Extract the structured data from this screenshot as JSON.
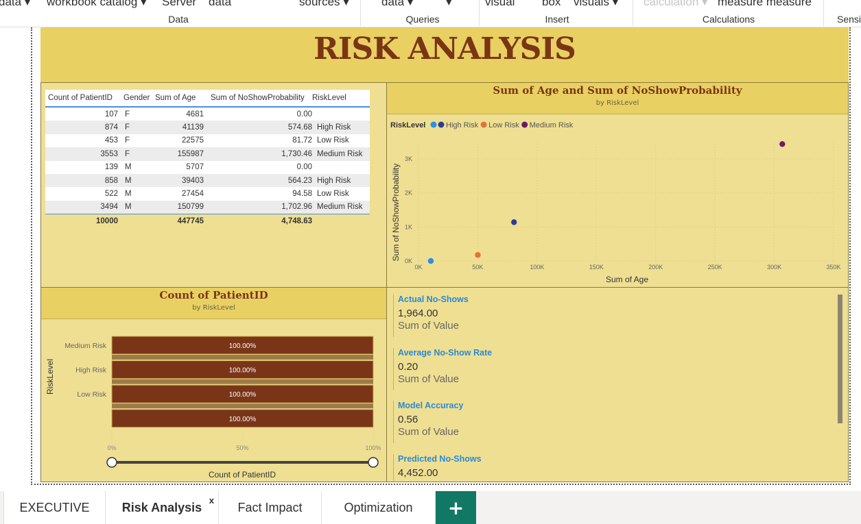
{
  "ribbon": {
    "top_fragments": [
      "data ▾",
      "workbook catalog ▾",
      "Server",
      "data",
      "sources ▾",
      "data ▾",
      "▾",
      "visual",
      "box",
      "visuals ▾",
      "calculation ▾",
      "measure measure"
    ],
    "groups": [
      "Data",
      "Queries",
      "Insert",
      "Calculations",
      "Sensi"
    ]
  },
  "report": {
    "title": "RISK ANALYSIS"
  },
  "table": {
    "columns": [
      "Count of PatientID",
      "Gender",
      "Sum of Age",
      "Sum of NoShowProbability",
      "RiskLevel"
    ],
    "rows": [
      [
        "107",
        "F",
        "4681",
        "0.00",
        ""
      ],
      [
        "874",
        "F",
        "41139",
        "574.68",
        "High Risk"
      ],
      [
        "453",
        "F",
        "22575",
        "81.72",
        "Low Risk"
      ],
      [
        "3553",
        "F",
        "155987",
        "1,730.46",
        "Medium Risk"
      ],
      [
        "139",
        "M",
        "5707",
        "0.00",
        ""
      ],
      [
        "858",
        "M",
        "39403",
        "564.23",
        "High Risk"
      ],
      [
        "522",
        "M",
        "27454",
        "94.58",
        "Low Risk"
      ],
      [
        "3494",
        "M",
        "150799",
        "1,702.96",
        "Medium Risk"
      ]
    ],
    "total": [
      "10000",
      "",
      "447745",
      "4,748.63",
      ""
    ]
  },
  "chart_data": [
    {
      "type": "scatter",
      "title": "Sum of Age and Sum of NoShowProbability",
      "subtitle": "by RiskLevel",
      "xlabel": "Sum of Age",
      "ylabel": "Sum of NoShowProbability",
      "legend_title": "RiskLevel",
      "legend_position": "top-left",
      "xlim": [
        0,
        350000
      ],
      "ylim": [
        0,
        3500
      ],
      "x_ticks": [
        "0K",
        "50K",
        "100K",
        "150K",
        "200K",
        "250K",
        "300K",
        "350K"
      ],
      "y_ticks": [
        "0K",
        "1K",
        "2K",
        "3K"
      ],
      "grid": true,
      "series": [
        {
          "name": "",
          "color": "#2b8fe5",
          "points": [
            {
              "x": 10388,
              "y": 0
            }
          ]
        },
        {
          "name": "High Risk",
          "color": "#2e3b9c",
          "points": [
            {
              "x": 80542,
              "y": 1138.91
            }
          ]
        },
        {
          "name": "Low Risk",
          "color": "#e8703a",
          "points": [
            {
              "x": 50029,
              "y": 176.3
            }
          ]
        },
        {
          "name": "Medium Risk",
          "color": "#6a1b6e",
          "points": [
            {
              "x": 306786,
              "y": 3433.42
            }
          ]
        }
      ]
    },
    {
      "type": "bar",
      "orientation": "horizontal",
      "stacked_percent": true,
      "title": "Count of PatientID",
      "subtitle": "by RiskLevel",
      "xlabel": "Count of PatientID",
      "ylabel": "RiskLevel",
      "categories": [
        "Medium Risk",
        "High Risk",
        "Low Risk",
        ""
      ],
      "values": [
        100,
        100,
        100,
        100
      ],
      "value_labels": [
        "100.00%",
        "100.00%",
        "100.00%",
        "100.00%"
      ],
      "x_ticks": [
        "0%",
        "50%",
        "100%"
      ],
      "xlim": [
        0,
        100
      ],
      "bar_color": "#7a3519"
    }
  ],
  "cards": [
    {
      "label": "Actual No-Shows",
      "value": "1,964.00",
      "caption": "Sum of Value"
    },
    {
      "label": "Average No-Show Rate",
      "value": "0.20",
      "caption": "Sum of Value"
    },
    {
      "label": "Model Accuracy",
      "value": "0.56",
      "caption": "Sum of Value"
    },
    {
      "label": "Predicted No-Shows",
      "value": "4,452.00",
      "caption": ""
    }
  ],
  "tabs": [
    {
      "label": "EXECUTIVE"
    },
    {
      "label": "Risk Analysis",
      "close": "x"
    },
    {
      "label": "Fact Impact"
    },
    {
      "label": "Optimization"
    }
  ],
  "add_tab": "+",
  "colors": {
    "title_band": "#e8d063",
    "panel_bg": "#efdf92",
    "title_text": "#7a3515",
    "card_label": "#2a8ad4",
    "add_tab": "#117865"
  }
}
